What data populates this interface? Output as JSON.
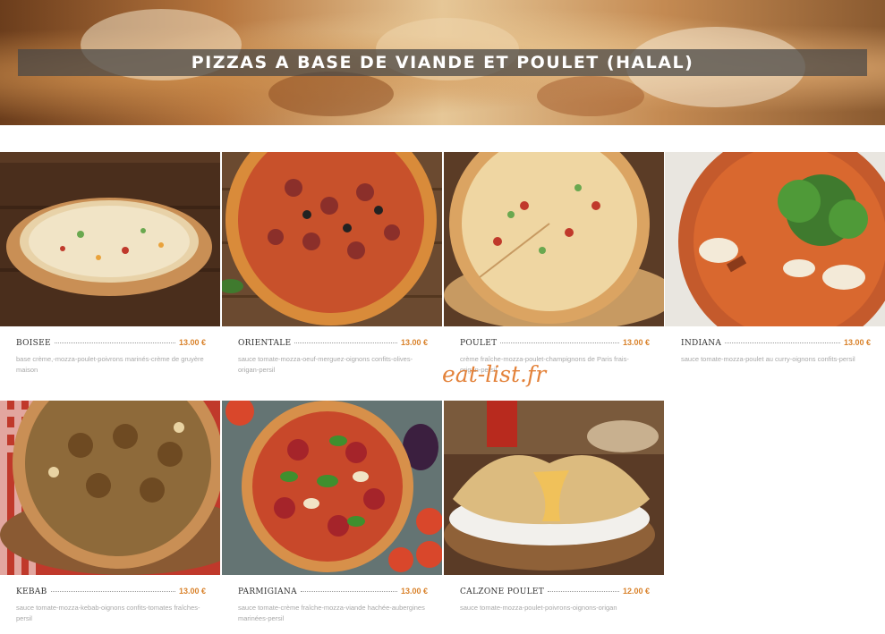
{
  "banner": {
    "title": "PIZZAS A BASE DE VIANDE ET POULET (HALAL)"
  },
  "watermark": "eat-list.fr",
  "items": [
    {
      "name": "BOISEE",
      "price": "13.00 €",
      "desc": "base crème,-mozza-poulet-poivrons marinés-crème de gruyère maison"
    },
    {
      "name": "ORIENTALE",
      "price": "13.00 €",
      "desc": "sauce tomate-mozza-oeuf-merguez-oignons confits-olives-origan-persil"
    },
    {
      "name": "POULET",
      "price": "13.00 €",
      "desc": "crème fraîche-mozza-poulet-champignons de Paris frais-origan-persil"
    },
    {
      "name": "INDIANA",
      "price": "13.00 €",
      "desc": "sauce tomate-mozza-poulet au curry-oignons confits-persil"
    },
    {
      "name": "KEBAB",
      "price": "13.00 €",
      "desc": "sauce tomate-mozza-kebab-oignons confits-tomates fraîches-persil"
    },
    {
      "name": "PARMIGIANA",
      "price": "13.00 €",
      "desc": "sauce tomate-crème fraîche-mozza-viande hachée-aubergines marinées-persil"
    },
    {
      "name": "CALZONE POULET",
      "price": "12.00 €",
      "desc": "sauce tomate-mozza-poulet-poivrons-oignons-origan"
    }
  ],
  "colors": {
    "price": "#d9822b",
    "watermark": "#e3823a",
    "banner_bar": "#464646"
  }
}
